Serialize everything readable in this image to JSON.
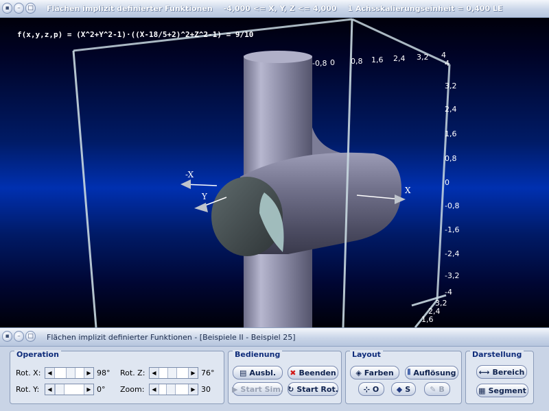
{
  "window": {
    "title": "Flächen implizit definierter Funktionen",
    "range": "-4,000 <= X, Y, Z <= 4,000",
    "scale": "1 Achsskalierungseinheit = 0,400 LE"
  },
  "graph": {
    "formula": "f(x,y,z,p) = (X^2+Y^2-1)·((X-18/5+2)^2+Z^2-1) = 9/10",
    "axis_labels": {
      "x": "X",
      "neg_x": "-X",
      "y": "Y"
    },
    "right_ticks": [
      "4",
      "3,2",
      "2,4",
      "1,6",
      "0,8",
      "0",
      "-0,8",
      "-1,6",
      "-2,4",
      "-3,2",
      "-4"
    ],
    "top_ticks": [
      "-0,8",
      "0",
      "0,8",
      "1,6",
      "2,4",
      "3,2",
      "4"
    ],
    "bottom_ticks": [
      "3,2",
      "2,4",
      "1,6"
    ],
    "colors": {
      "surface": "#8c8ca6",
      "cut": "#a8c8c8",
      "frame": "#c8d8e0"
    }
  },
  "window2": {
    "title": "Flächen implizit definierter Funktionen - [Beispiele II - Beispiel 25]"
  },
  "operation": {
    "title": "Operation",
    "rot_x": {
      "label": "Rot. X:",
      "value": "98°"
    },
    "rot_y": {
      "label": "Rot. Y:",
      "value": "0°"
    },
    "rot_z": {
      "label": "Rot. Z:",
      "value": "76°"
    },
    "zoom": {
      "label": "Zoom:",
      "value": "30"
    }
  },
  "bedienung": {
    "title": "Bedienung",
    "ausbl": "Ausbl.",
    "beenden": "Beenden",
    "start_sim": "Start Sim.",
    "start_rot": "Start Rot."
  },
  "layout": {
    "title": "Layout",
    "farben": "Farben",
    "aufloesung": "Auflösung",
    "o": "O",
    "s": "S",
    "b": "B"
  },
  "darstellung": {
    "title": "Darstellung",
    "bereich": "Bereich",
    "segment": "Segment"
  }
}
